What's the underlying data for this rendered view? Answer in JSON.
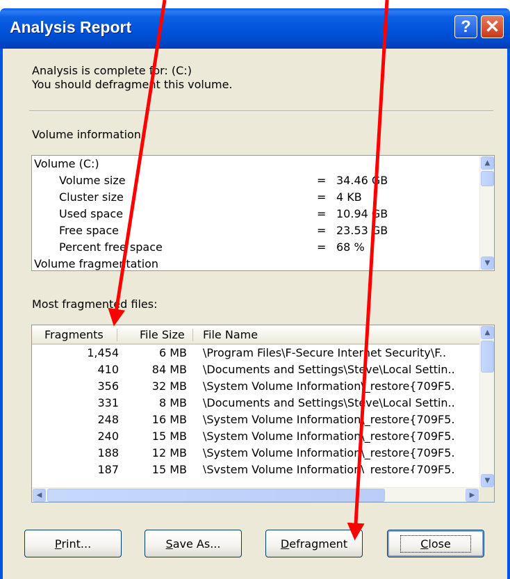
{
  "window": {
    "title": "Analysis Report"
  },
  "title_buttons": {
    "help": "?",
    "close": "✕"
  },
  "status": {
    "line1": "Analysis is complete for: (C:)",
    "line2": "You should defragment this volume."
  },
  "volume_info": {
    "label": "Volume information:",
    "heading": "Volume  (C:)",
    "rows": [
      {
        "name": "Volume size",
        "eq": "=",
        "value": "34.46 GB"
      },
      {
        "name": "Cluster size",
        "eq": "=",
        "value": "4 KB"
      },
      {
        "name": "Used space",
        "eq": "=",
        "value": "10.94 GB"
      },
      {
        "name": "Free space",
        "eq": "=",
        "value": "23.53 GB"
      },
      {
        "name": "Percent free space",
        "eq": "=",
        "value": "68 %"
      }
    ],
    "last_row": "Volume fragmentation"
  },
  "files": {
    "label": "Most fragmented files:",
    "columns": [
      "Fragments",
      "File Size",
      "File Name"
    ],
    "rows": [
      {
        "fragments": "1,454",
        "size": "6 MB",
        "name": "\\Program Files\\F-Secure Internet Security\\F.."
      },
      {
        "fragments": "410",
        "size": "84 MB",
        "name": "\\Documents and Settings\\Steve\\Local Settin.."
      },
      {
        "fragments": "356",
        "size": "32 MB",
        "name": "\\System Volume Information\\_restore{709F5."
      },
      {
        "fragments": "331",
        "size": "8 MB",
        "name": "\\Documents and Settings\\Steve\\Local Settin.."
      },
      {
        "fragments": "248",
        "size": "16 MB",
        "name": "\\System Volume Information\\_restore{709F5."
      },
      {
        "fragments": "240",
        "size": "15 MB",
        "name": "\\System Volume Information\\_restore{709F5."
      },
      {
        "fragments": "188",
        "size": "12 MB",
        "name": "\\System Volume Information\\_restore{709F5."
      },
      {
        "fragments": "187",
        "size": "15 MB",
        "name": "\\System Volume Information\\_restore{709F5."
      }
    ]
  },
  "buttons": {
    "print_key": "P",
    "print_rest": "rint...",
    "save_key": "S",
    "save_rest": "ave As...",
    "defrag_key": "D",
    "defrag_rest": "efragment",
    "close_key": "C",
    "close_rest": "lose"
  },
  "colors": {
    "titlebar": "#0054e3",
    "dialog_bg": "#ece9d8",
    "annotation_arrow": "#ff0000"
  }
}
